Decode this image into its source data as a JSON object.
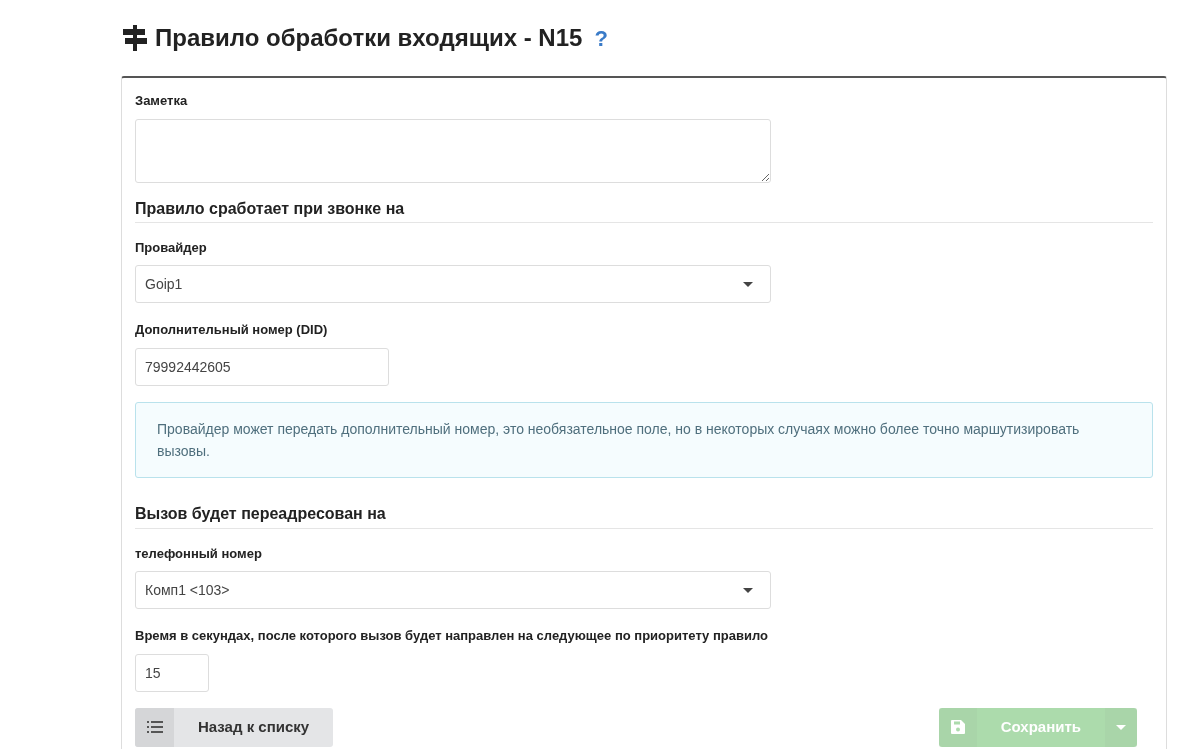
{
  "page_title": "Правило обработки входящих - N15",
  "help": "?",
  "note": {
    "label": "Заметка"
  },
  "trigger_section": {
    "heading": "Правило сработает при звонке на"
  },
  "provider": {
    "label": "Провайдер",
    "value": "Goip1"
  },
  "did": {
    "label": "Дополнительный номер (DID)",
    "value": "79992442605"
  },
  "info_alert": "Провайдер может передать дополнительный номер, это необязательное поле, но в некоторых случаях можно более точно маршутизировать вызовы.",
  "forward_section": {
    "heading": "Вызов будет переадресован на"
  },
  "phone": {
    "label": "телефонный номер",
    "value": "Комп1 <103>"
  },
  "timeout": {
    "label": "Время в секундах, после которого вызов будет направлен на следующее по приоритету правило",
    "value": "15"
  },
  "back_button": {
    "label": "Назад к списку"
  },
  "save_button": {
    "label": "Сохранить",
    "disabled": true
  }
}
